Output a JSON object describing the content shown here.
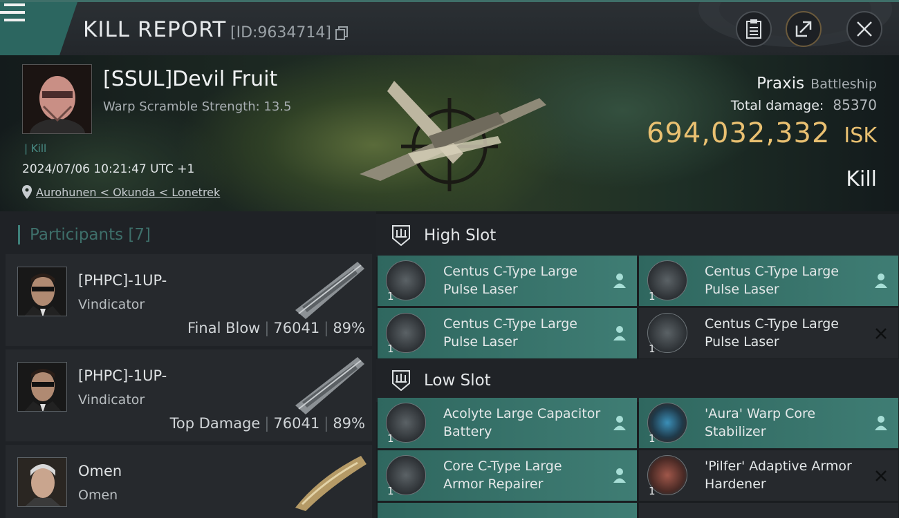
{
  "header": {
    "title": "KILL REPORT",
    "id_text": "[ID:9634714]"
  },
  "victim": {
    "name": "[SSUL]Devil Fruit",
    "scramble": "Warp Scramble Strength: 13.5",
    "tag": "Kill",
    "timestamp": "2024/07/06 10:21:47 UTC +1",
    "location": "Aurohunen < Okunda < Lonetrek",
    "ship_name": "Praxis",
    "ship_class": "Battleship",
    "damage_label": "Total damage:",
    "damage_value": "85370",
    "isk_value": "694,032,332",
    "isk_unit": "ISK",
    "result": "Kill"
  },
  "participants": {
    "title": "Participants [7]",
    "items": [
      {
        "name": "[PHPC]-1UP-",
        "ship": "Vindicator",
        "role": "Final Blow",
        "damage": "76041",
        "percent": "89%"
      },
      {
        "name": "[PHPC]-1UP-",
        "ship": "Vindicator",
        "role": "Top Damage",
        "damage": "76041",
        "percent": "89%"
      },
      {
        "name": "Omen",
        "ship": "Omen",
        "role": "",
        "damage": "",
        "percent": ""
      }
    ]
  },
  "modules": {
    "high_slot_label": "High Slot",
    "low_slot_label": "Low Slot",
    "high": [
      {
        "name": "Centus C-Type Large Pulse Laser",
        "qty": "1",
        "status": "dropped"
      },
      {
        "name": "Centus C-Type Large Pulse Laser",
        "qty": "1",
        "status": "dropped"
      },
      {
        "name": "Centus C-Type Large Pulse Laser",
        "qty": "1",
        "status": "dropped"
      },
      {
        "name": "Centus C-Type Large Pulse Laser",
        "qty": "1",
        "status": "destroyed"
      }
    ],
    "low": [
      {
        "name": "Acolyte Large Capacitor Battery",
        "qty": "1",
        "status": "dropped"
      },
      {
        "name": "'Aura' Warp Core Stabilizer",
        "qty": "1",
        "status": "dropped"
      },
      {
        "name": "Core C-Type Large Armor Repairer",
        "qty": "1",
        "status": "dropped"
      },
      {
        "name": "'Pilfer' Adaptive Armor Hardener",
        "qty": "1",
        "status": "destroyed"
      }
    ]
  },
  "colors": {
    "accent": "#3f807a",
    "isk": "#e9c071",
    "module_alive": "#3f7d74",
    "module_lost": "#26292d"
  }
}
